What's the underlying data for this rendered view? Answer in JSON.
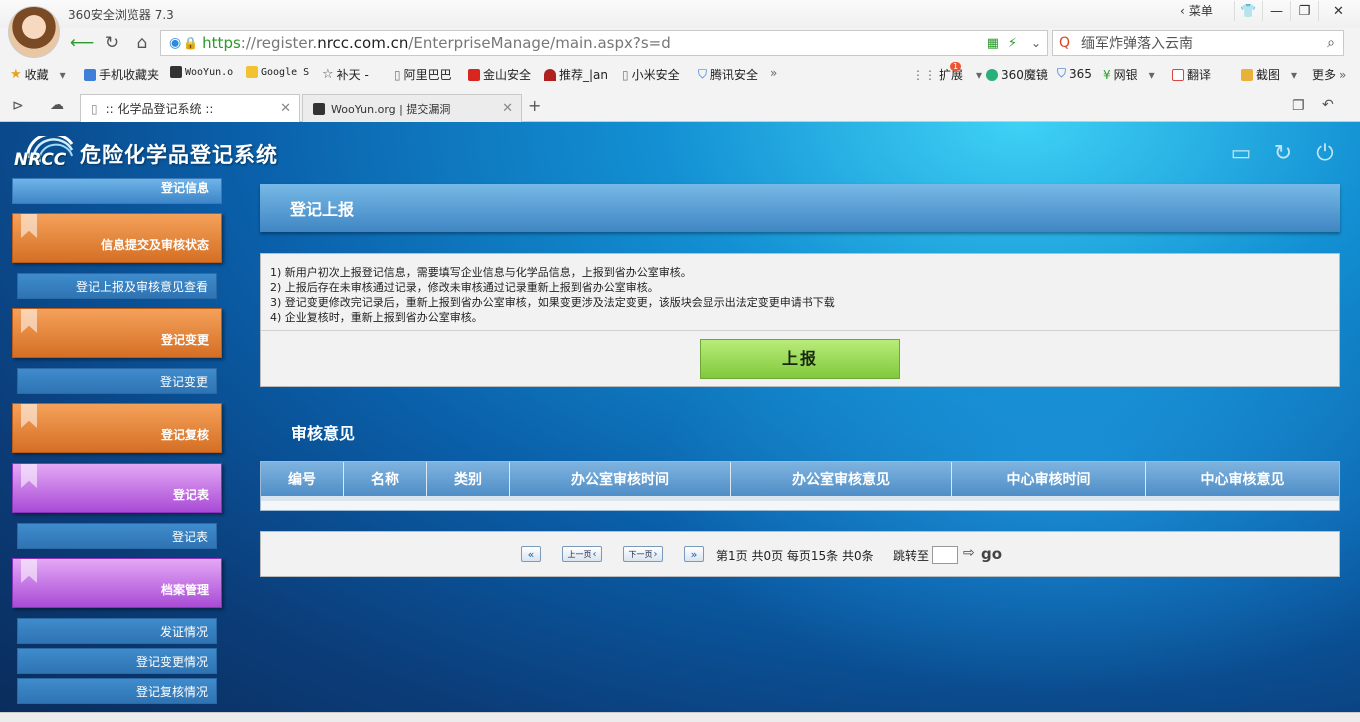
{
  "browser": {
    "app_title": "360安全浏览器 7.3",
    "menu_label": "菜单",
    "url_https": "https",
    "url_pre": "://register.",
    "url_domain": "nrcc.com.cn",
    "url_path": "/EnterpriseManage/main.aspx?s=d",
    "search_text": "缅军炸弹落入云南",
    "favorites": [
      {
        "label": "收藏"
      },
      {
        "label": "手机收藏夹"
      },
      {
        "label": "WooYun.o"
      },
      {
        "label": "Google S"
      },
      {
        "label": "补天 -"
      },
      {
        "label": "阿里巴巴"
      },
      {
        "label": "金山安全"
      },
      {
        "label": "推荐_|an"
      },
      {
        "label": "小米安全"
      },
      {
        "label": "腾讯安全"
      }
    ],
    "right_tools": [
      {
        "label": "扩展"
      },
      {
        "label": "360魔镜"
      },
      {
        "label": "365"
      },
      {
        "label": "网银"
      },
      {
        "label": "翻译"
      },
      {
        "label": "截图"
      },
      {
        "label": "更多"
      }
    ],
    "extension_badge": "1",
    "tabs": [
      {
        "label": ":: 化学品登记系统 ::"
      },
      {
        "label": "WooYun.org | 提交漏洞"
      }
    ]
  },
  "page": {
    "logo_abbr": "NRCC",
    "system_title": "危险化学品登记系统",
    "sidebar": {
      "top_partial": "登记信息",
      "items": [
        {
          "label": "信息提交及审核状态",
          "sub": "登记上报及审核意见查看"
        },
        {
          "label": "登记变更",
          "sub": "登记变更"
        },
        {
          "label": "登记复核"
        },
        {
          "label": "登记表",
          "sub": "登记表"
        },
        {
          "label": "档案管理"
        }
      ],
      "archive_subs": [
        "发证情况",
        "登记变更情况",
        "登记复核情况"
      ]
    },
    "report_title": "登记上报",
    "instructions": [
      "1) 新用户初次上报登记信息，需要填写企业信息与化学品信息，上报到省办公室审核。",
      "2) 上报后存在未审核通过记录，修改未审核通过记录重新上报到省办公室审核。",
      "3) 登记变更修改完记录后，重新上报到省办公室审核，如果变更涉及法定变更，该版块会显示出法定变更申请书下载",
      "4) 企业复核时，重新上报到省办公室审核。"
    ],
    "submit_label": "上报",
    "review_title": "审核意见",
    "table_headers": [
      "编号",
      "名称",
      "类别",
      "办公室审核时间",
      "办公室审核意见",
      "中心审核时间",
      "中心审核意见"
    ],
    "pager": {
      "first": "",
      "prev": "上一页",
      "next": "下一页",
      "last": "",
      "summary": "第1页 共0页 每页15条 共0条",
      "jump_label": "跳转至",
      "go_label": "go"
    }
  }
}
